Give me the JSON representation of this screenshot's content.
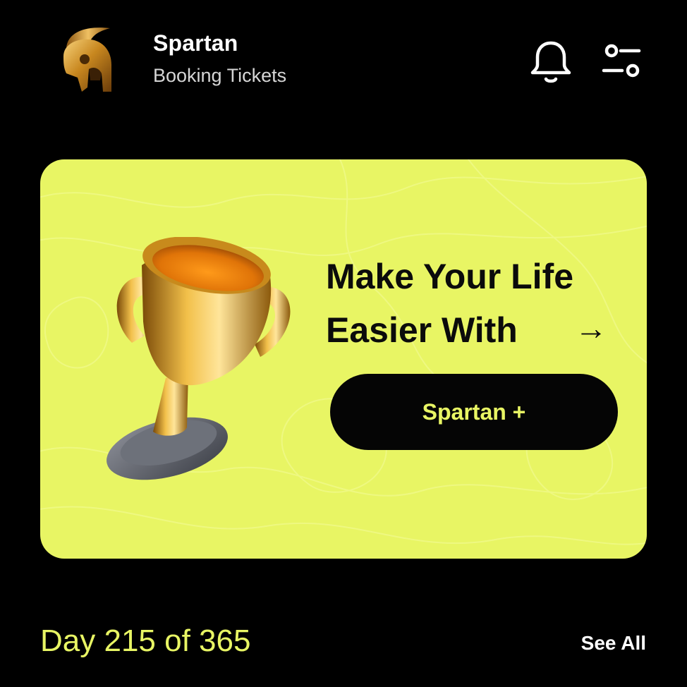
{
  "header": {
    "brand_name": "Spartan",
    "brand_subtitle": "Booking Tickets",
    "logo_icon": "spartan-helmet-icon",
    "notification_icon": "bell-icon",
    "filter_icon": "sliders-icon"
  },
  "promo": {
    "title_line1": "Make Your Life",
    "title_line2": "Easier With",
    "arrow": "→",
    "cta_label": "Spartan +",
    "image_icon": "trophy-icon",
    "background_color": "#e8f564"
  },
  "progress": {
    "day_label": "Day 215 of 365",
    "see_all_label": "See All"
  },
  "colors": {
    "accent": "#e8f564",
    "background": "#000000",
    "text": "#ffffff"
  }
}
